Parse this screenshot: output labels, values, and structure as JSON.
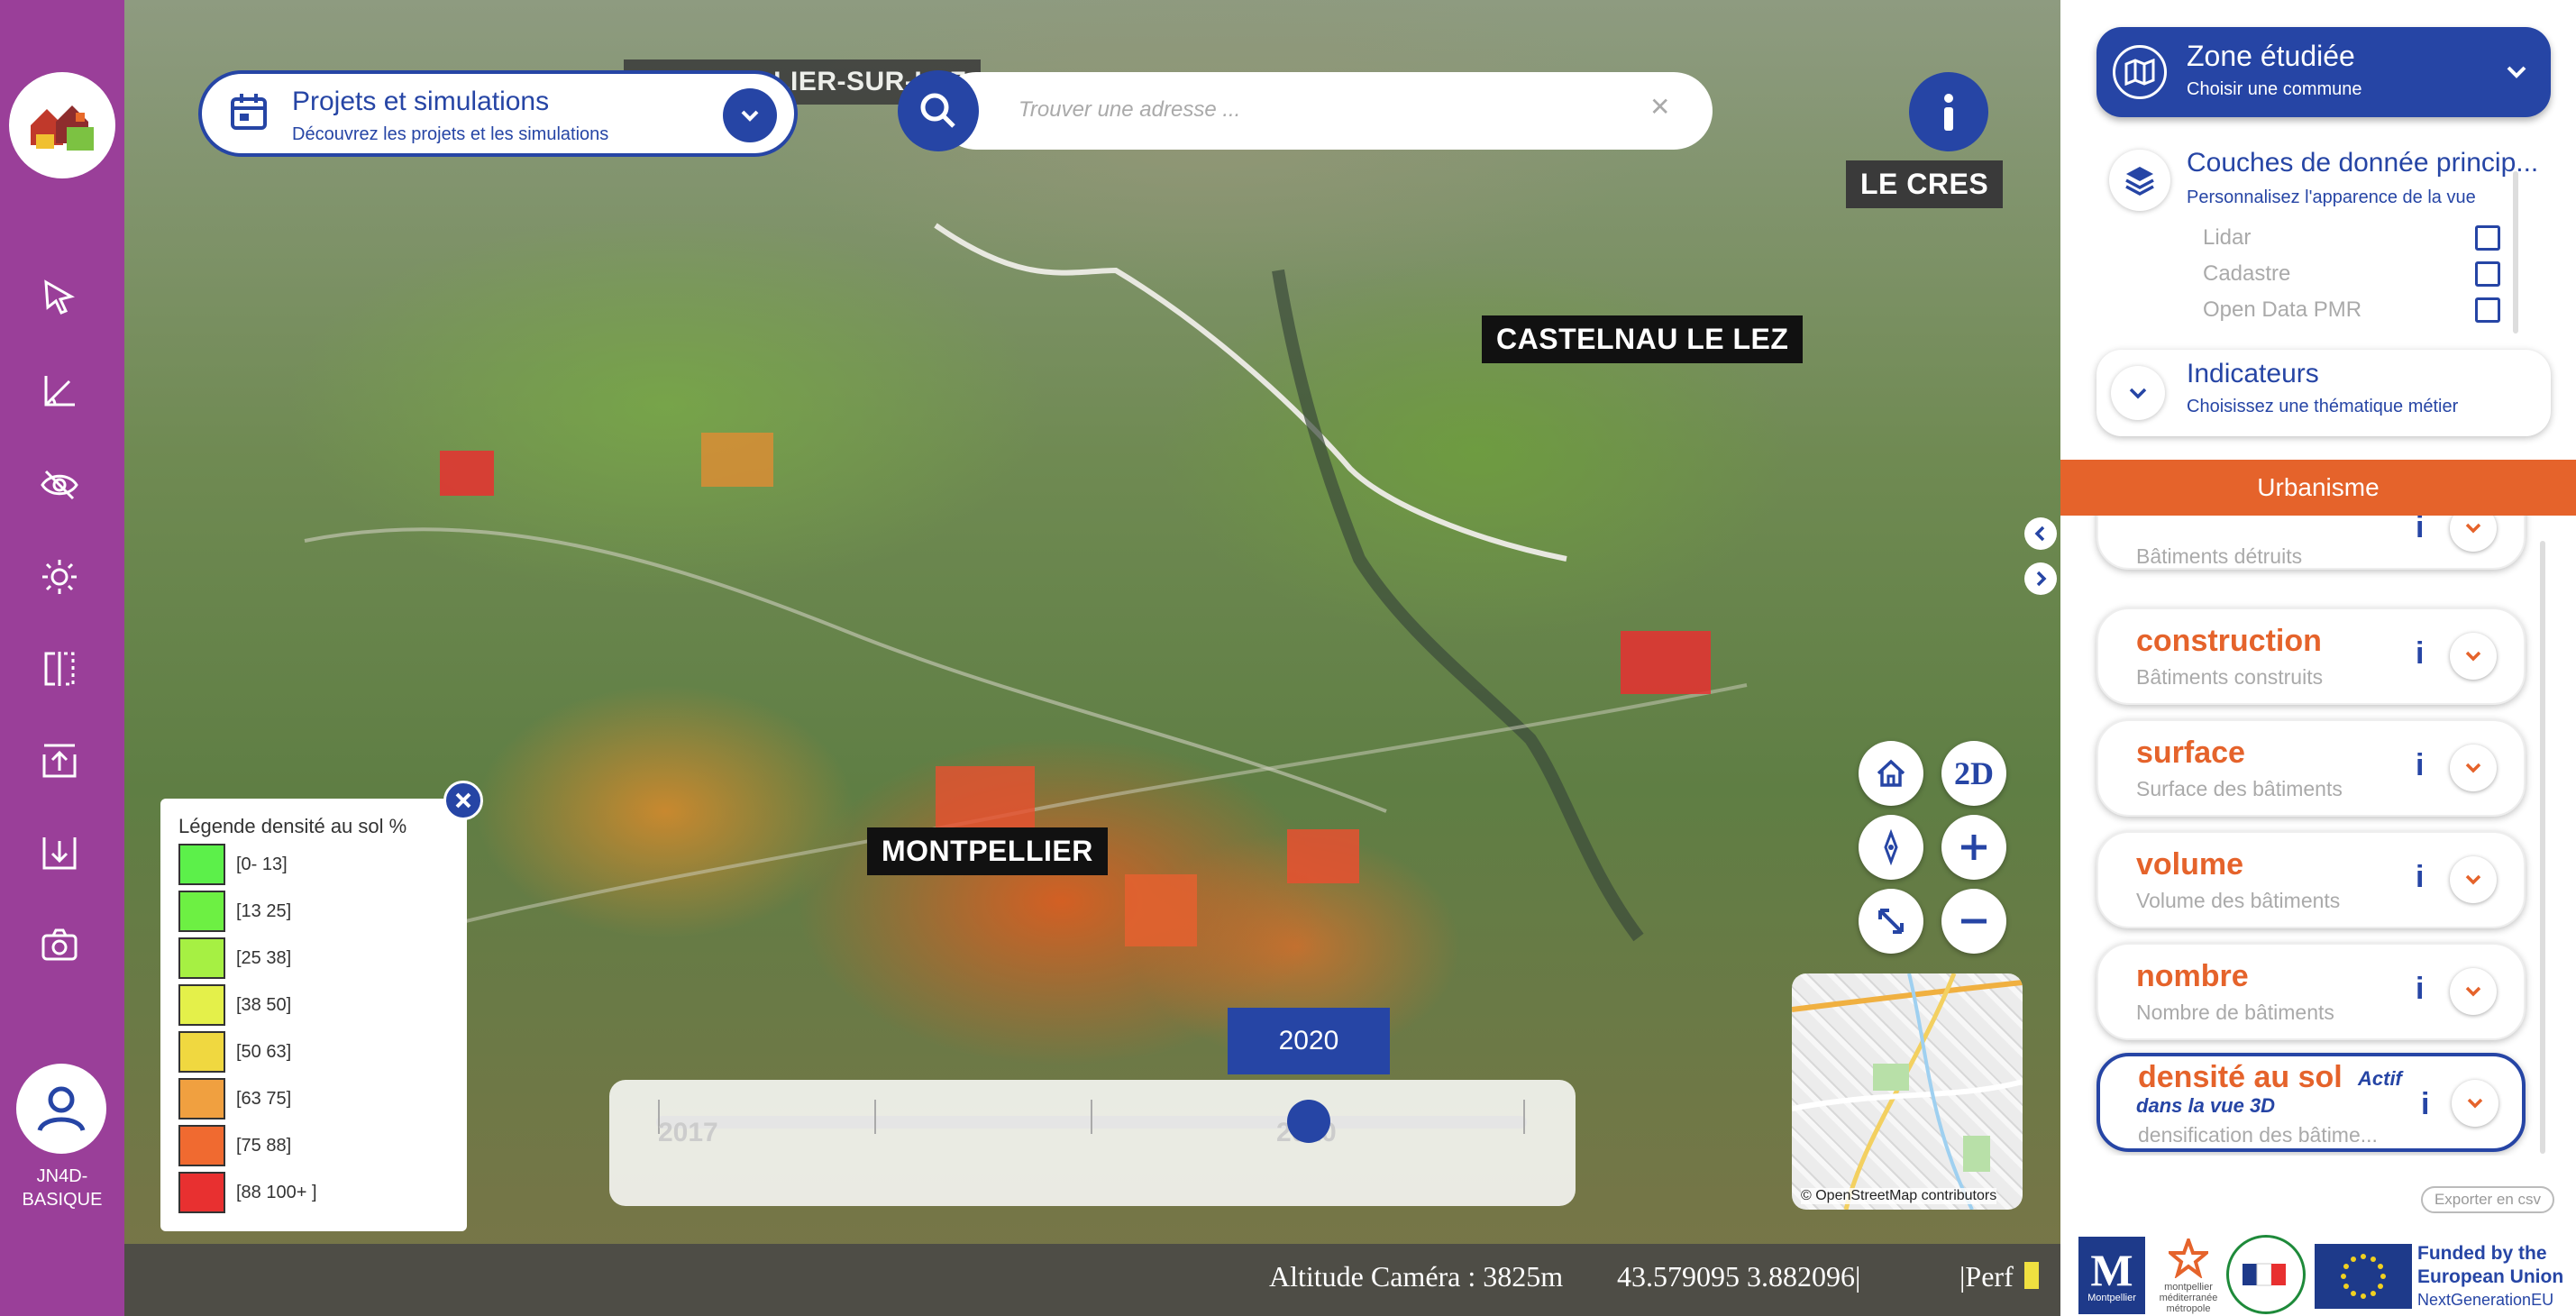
{
  "sidebar": {
    "user": "JN4D-\nBASIQUE",
    "user_line1": "JN4D-",
    "user_line2": "BASIQUE"
  },
  "projets": {
    "title": "Projets et simulations",
    "subtitle": "Découvrez les projets et les simulations"
  },
  "search": {
    "placeholder": "Trouver une adresse ..."
  },
  "map_labels": {
    "top_partial": "MONTPELLIER-SUR-LEZ",
    "le_cres": "LE CRES",
    "castelnau": "CASTELNAU LE LEZ",
    "montpellier": "MONTPELLIER"
  },
  "controls": {
    "two_d": "2D"
  },
  "legend": {
    "title": "Légende densité au sol %",
    "items": [
      {
        "label": "[0- 13]",
        "color": "#5cf04a"
      },
      {
        "label": "[13 25]",
        "color": "#6df043"
      },
      {
        "label": "[25 38]",
        "color": "#a6f043"
      },
      {
        "label": "[38 50]",
        "color": "#e4f04a"
      },
      {
        "label": "[50 63]",
        "color": "#f0d840"
      },
      {
        "label": "[63 75]",
        "color": "#f0a040"
      },
      {
        "label": "[75 88]",
        "color": "#f06a30"
      },
      {
        "label": "[88 100+ ]",
        "color": "#e83030"
      }
    ]
  },
  "timeline": {
    "selected_year": "2020",
    "start_label": "2017",
    "knob_label": "2020"
  },
  "minimap": {
    "attribution": "© OpenStreetMap contributors"
  },
  "status": {
    "altitude": "Altitude Caméra : 3825m",
    "coords": "43.579095 3.882096|",
    "perf": "|Perf"
  },
  "right_panel": {
    "zone": {
      "title": "Zone étudiée",
      "subtitle": "Choisir une commune"
    },
    "couches": {
      "title": "Couches de donnée princip...",
      "subtitle": "Personnalisez l'apparence de la vue",
      "items": [
        "Lidar",
        "Cadastre",
        "Open Data PMR"
      ]
    },
    "indicateurs": {
      "title": "Indicateurs",
      "subtitle": "Choisissez une thématique métier"
    },
    "category": "Urbanisme",
    "cards": [
      {
        "name": "",
        "desc": "Bâtiments détruits"
      },
      {
        "name": "construction",
        "desc": "Bâtiments construits"
      },
      {
        "name": "surface",
        "desc": "Surface des bâtiments"
      },
      {
        "name": "volume",
        "desc": "Volume des bâtiments"
      },
      {
        "name": "nombre",
        "desc": "Nombre de bâtiments"
      },
      {
        "name": "densité au sol",
        "desc": "densification des bâtime..."
      }
    ],
    "actif": "Actif",
    "vue3d": "dans la vue 3D",
    "info_glyph": "i",
    "export": "Exporter en csv"
  },
  "footer": {
    "funded_line1": "Funded by the",
    "funded_line2": "European Union",
    "nextgen": "NextGenerationEU",
    "montpellier_caption": "Montpellier",
    "metropole": "montpellier",
    "metropole2": "méditerranée",
    "metropole3": "métropole"
  },
  "colors": {
    "brand_blue": "#2645a5",
    "sidebar_purple": "#9a3f99",
    "accent_orange": "#e5632b"
  }
}
